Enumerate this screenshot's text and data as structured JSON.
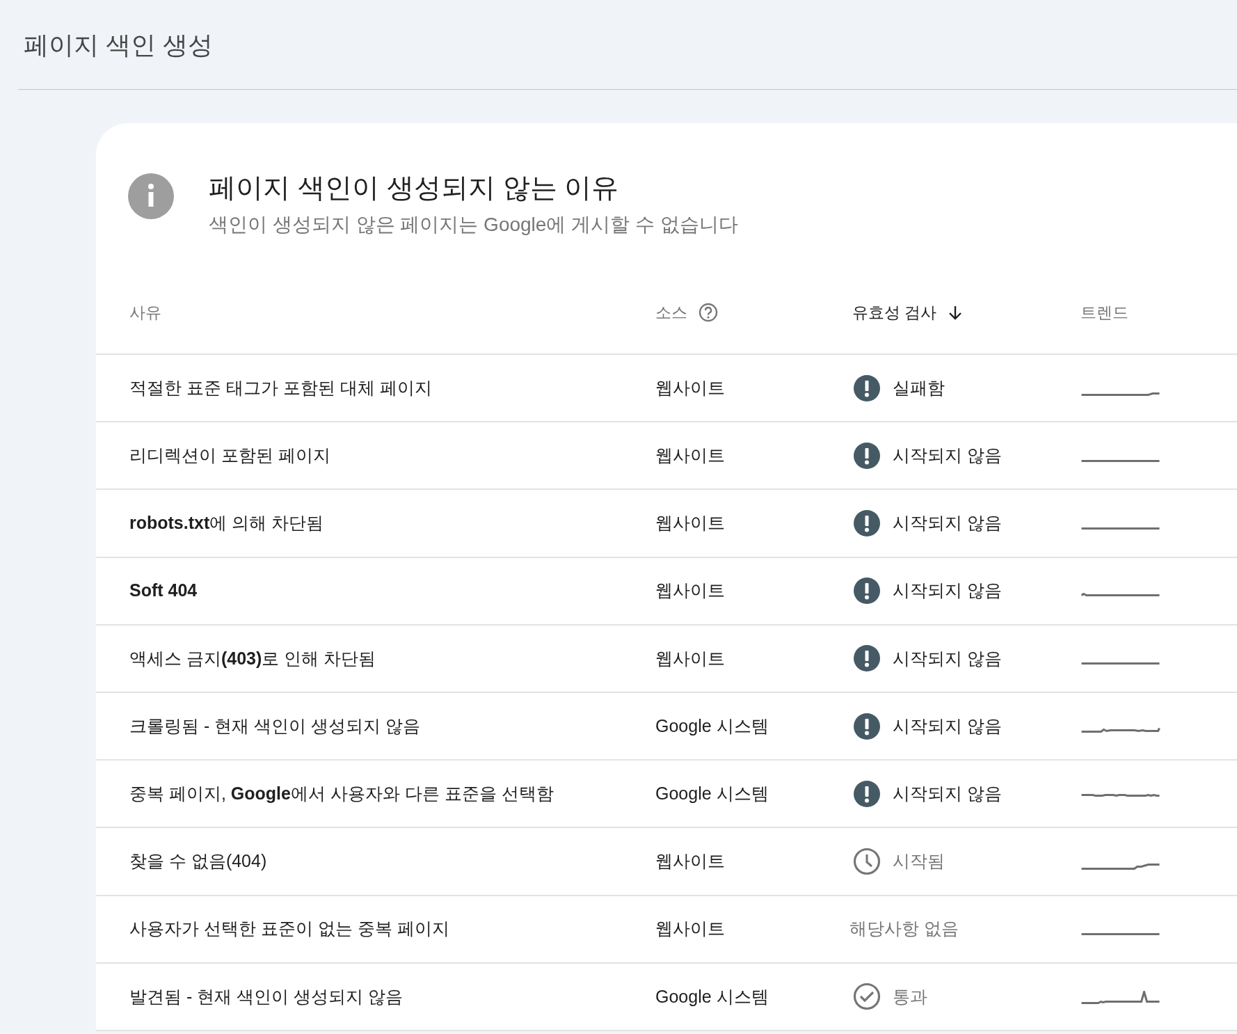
{
  "page_title": "페이지 색인 생성",
  "card": {
    "title": "페이지 색인이 생성되지 않는 이유",
    "subtitle": "색인이 생성되지 않은 페이지는 Google에 게시할 수 없습니다"
  },
  "table": {
    "columns": [
      {
        "label": "사유",
        "kind": "plain"
      },
      {
        "label": "소스",
        "kind": "help"
      },
      {
        "label": "유효성 검사",
        "kind": "sorted"
      },
      {
        "label": "트렌드",
        "kind": "plain"
      }
    ],
    "rows": [
      {
        "reason": "적절한 표준 태그가 포함된 대체 페이지",
        "source": "웹사이트",
        "validation": {
          "kind": "failed",
          "label": "실패함"
        }
      },
      {
        "reason": "리디렉션이 포함된 페이지",
        "source": "웹사이트",
        "validation": {
          "kind": "not_started",
          "label": "시작되지 않음"
        }
      },
      {
        "reason": "**robots.txt**에 의해 차단됨",
        "source": "웹사이트",
        "validation": {
          "kind": "not_started",
          "label": "시작되지 않음"
        }
      },
      {
        "reason": "**Soft 404**",
        "source": "웹사이트",
        "validation": {
          "kind": "not_started",
          "label": "시작되지 않음"
        }
      },
      {
        "reason": "액세스 금지**(403)**로 인해 차단됨",
        "source": "웹사이트",
        "validation": {
          "kind": "not_started",
          "label": "시작되지 않음"
        }
      },
      {
        "reason": "크롤링됨 - 현재 색인이 생성되지 않음",
        "source": "Google 시스템",
        "validation": {
          "kind": "not_started",
          "label": "시작되지 않음"
        }
      },
      {
        "reason": "중복 페이지, **Google**에서 사용자와 다른 표준을 선택함",
        "source": "Google 시스템",
        "validation": {
          "kind": "not_started",
          "label": "시작되지 않음"
        }
      },
      {
        "reason": "찾을 수 없음(404)",
        "source": "웹사이트",
        "validation": {
          "kind": "started",
          "label": "시작됨"
        }
      },
      {
        "reason": "사용자가 선택한 표준이 없는 중복 페이지",
        "source": "웹사이트",
        "validation": {
          "kind": "none",
          "label": "해당사항 없음"
        }
      },
      {
        "reason": "발견됨 - 현재 색인이 생성되지 않음",
        "source": "Google 시스템",
        "validation": {
          "kind": "passed",
          "label": "통과"
        }
      }
    ]
  }
}
